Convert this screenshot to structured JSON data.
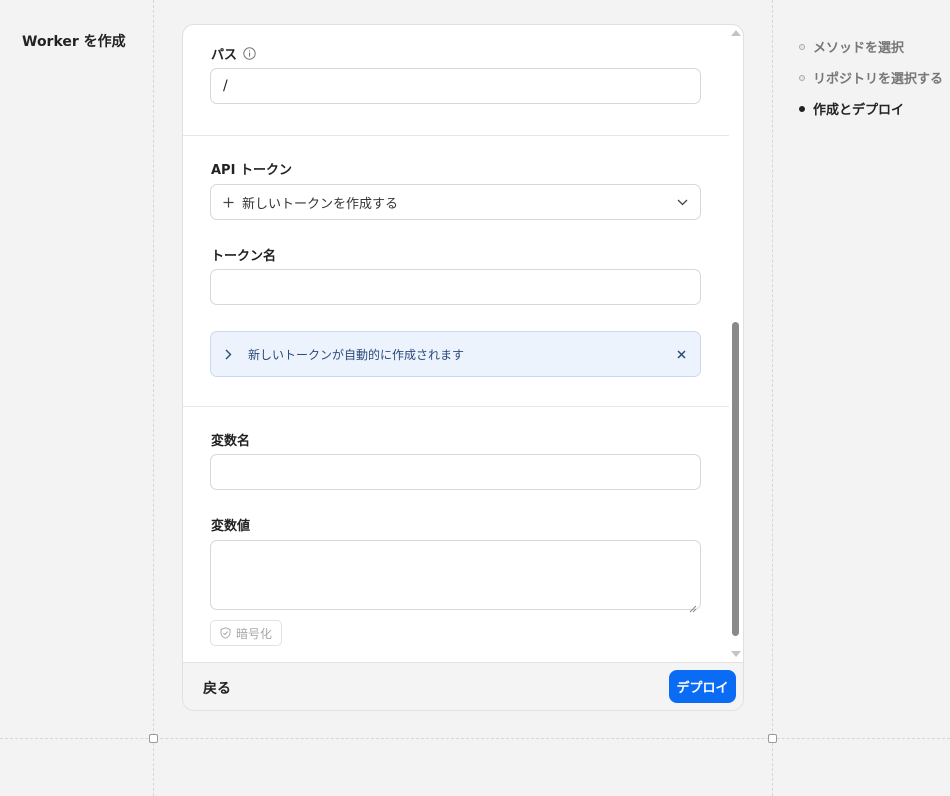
{
  "page": {
    "title": "Worker を作成"
  },
  "form": {
    "path": {
      "label": "パス",
      "value": "/"
    },
    "api_token": {
      "label": "API トークン",
      "selected": "新しいトークンを作成する"
    },
    "token_name": {
      "label": "トークン名",
      "value": ""
    },
    "notice": {
      "text": "新しいトークンが自動的に作成されます"
    },
    "var_name": {
      "label": "変数名",
      "value": ""
    },
    "var_value": {
      "label": "変数値",
      "value": ""
    },
    "encrypt_label": "暗号化"
  },
  "footer": {
    "back_label": "戻る",
    "deploy_label": "デプロイ"
  },
  "steps": [
    {
      "label": "メソッドを選択",
      "state": "done"
    },
    {
      "label": "リポジトリを選択する",
      "state": "done"
    },
    {
      "label": "作成とデプロイ",
      "state": "current"
    }
  ],
  "colors": {
    "primary": "#0a6cf4",
    "notice_bg": "#ecf3fd",
    "background": "#f3f3f3"
  }
}
